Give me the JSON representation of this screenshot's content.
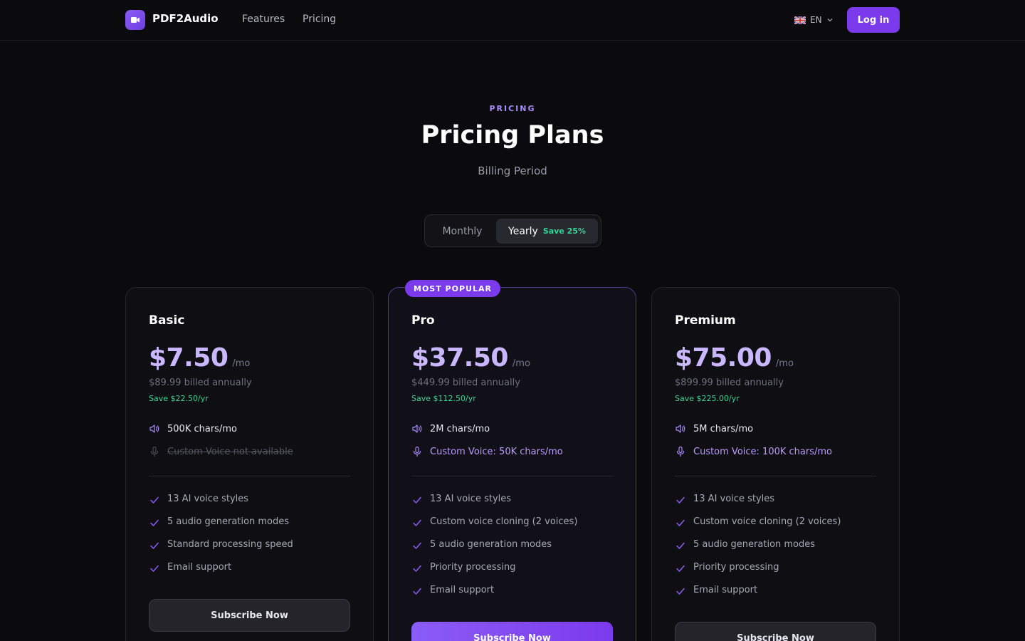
{
  "header": {
    "brand": "PDF2Audio",
    "nav": [
      {
        "label": "Features"
      },
      {
        "label": "Pricing"
      }
    ],
    "language": "EN",
    "login_label": "Log in"
  },
  "hero": {
    "eyebrow": "PRICING",
    "title": "Pricing Plans",
    "subtitle": "Billing Period"
  },
  "billing_toggle": {
    "monthly_label": "Monthly",
    "yearly_label": "Yearly",
    "yearly_badge": "Save 25%",
    "selected": "Yearly"
  },
  "colors": {
    "accent": "#7c3aed",
    "price": "#c9b8ff",
    "savings": "#34d399",
    "background": "#0b0b0e"
  },
  "plans": [
    {
      "name": "Basic",
      "price": "$7.50",
      "period": "/mo",
      "billed": "$89.99 billed annually",
      "savings": "Save $22.50/yr",
      "chars": "500K chars/mo",
      "custom_voice": "Custom Voice not available",
      "custom_voice_available": false,
      "features": [
        "13 AI voice styles",
        "5 audio generation modes",
        "Standard processing speed",
        "Email support"
      ],
      "cta": "Subscribe Now"
    },
    {
      "name": "Pro",
      "badge": "MOST POPULAR",
      "price": "$37.50",
      "period": "/mo",
      "billed": "$449.99 billed annually",
      "savings": "Save $112.50/yr",
      "chars": "2M chars/mo",
      "custom_voice": "Custom Voice: 50K chars/mo",
      "custom_voice_available": true,
      "features": [
        "13 AI voice styles",
        "Custom voice cloning (2 voices)",
        "5 audio generation modes",
        "Priority processing",
        "Email support"
      ],
      "cta": "Subscribe Now"
    },
    {
      "name": "Premium",
      "price": "$75.00",
      "period": "/mo",
      "billed": "$899.99 billed annually",
      "savings": "Save $225.00/yr",
      "chars": "5M chars/mo",
      "custom_voice": "Custom Voice: 100K chars/mo",
      "custom_voice_available": true,
      "features": [
        "13 AI voice styles",
        "Custom voice cloning (2 voices)",
        "5 audio generation modes",
        "Priority processing",
        "Email support"
      ],
      "cta": "Subscribe Now"
    }
  ]
}
